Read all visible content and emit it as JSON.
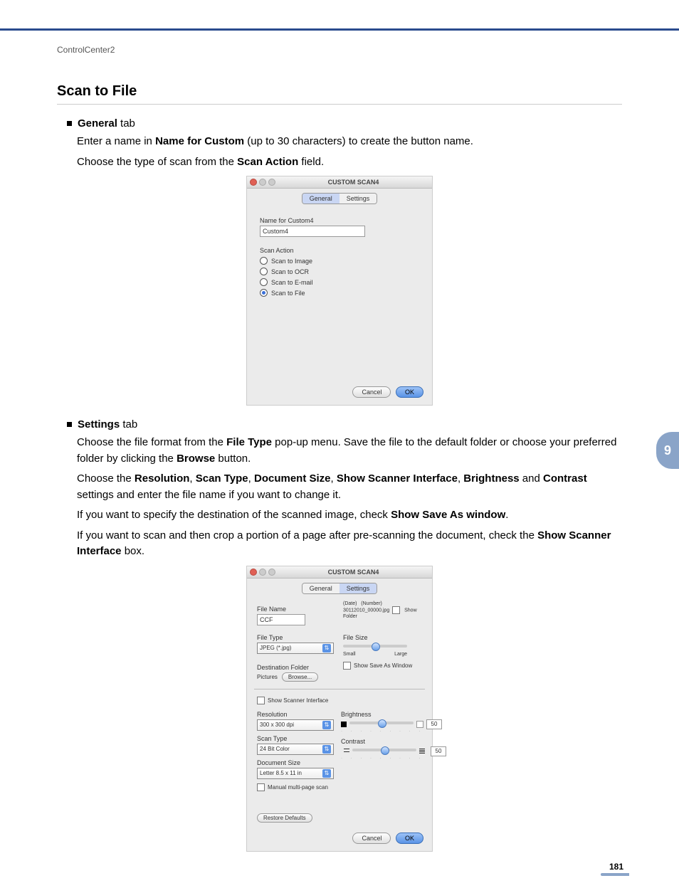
{
  "breadcrumb": "ControlCenter2",
  "heading": "Scan to File",
  "bullets": {
    "general_tab_strong": "General",
    "general_tab_rest": " tab",
    "settings_tab_strong": "Settings",
    "settings_tab_rest": " tab"
  },
  "paras": {
    "g1_a": "Enter a name in ",
    "g1_b": "Name for Custom",
    "g1_c": " (up to 30 characters) to create the button name.",
    "g2_a": "Choose the type of scan from the ",
    "g2_b": "Scan Action",
    "g2_c": " field.",
    "s1_a": "Choose the file format from the ",
    "s1_b": "File Type",
    "s1_c": " pop-up menu. Save the file to the default folder or choose your preferred folder by clicking the ",
    "s1_d": "Browse",
    "s1_e": " button.",
    "s2_a": "Choose the ",
    "s2_b": "Resolution",
    "s2_c": ", ",
    "s2_d": "Scan Type",
    "s2_e": ", ",
    "s2_f": "Document Size",
    "s2_g": ", ",
    "s2_h": "Show Scanner Interface",
    "s2_i": ", ",
    "s2_j": "Brightness",
    "s2_k": " and ",
    "s2_l": "Contrast",
    "s2_m": " settings and enter the file name if you want to change it.",
    "s3_a": "If you want to specify the destination of the scanned image, check ",
    "s3_b": "Show Save As window",
    "s3_c": ".",
    "s4_a": "If you want to scan and then crop a portion of a page after pre-scanning the document, check the ",
    "s4_b": "Show Scanner Interface",
    "s4_c": " box."
  },
  "shot1": {
    "title": "CUSTOM SCAN4",
    "tab_general": "General",
    "tab_settings": "Settings",
    "name_label": "Name for Custom4",
    "name_value": "Custom4",
    "action_label": "Scan Action",
    "opt_image": "Scan to Image",
    "opt_ocr": "Scan to OCR",
    "opt_email": "Scan to E-mail",
    "opt_file": "Scan to File",
    "cancel": "Cancel",
    "ok": "OK"
  },
  "shot2": {
    "title": "CUSTOM SCAN4",
    "tab_general": "General",
    "tab_settings": "Settings",
    "filename_lbl": "File Name",
    "filename_val": "CCF",
    "date_lbl": "(Date)",
    "number_lbl": "(Number)",
    "date_sample": "30112010_00000.jpg",
    "show_folder": "Show Folder",
    "filetype_lbl": "File Type",
    "filetype_val": "JPEG (*.jpg)",
    "filesize_lbl": "File Size",
    "small": "Small",
    "large": "Large",
    "dest_lbl": "Destination Folder",
    "dest_val": "Pictures",
    "browse": "Browse...",
    "show_save_as": "Show Save As Window",
    "show_scanner_if": "Show Scanner Interface",
    "res_lbl": "Resolution",
    "res_val": "300 x 300 dpi",
    "brightness_lbl": "Brightness",
    "scantype_lbl": "Scan Type",
    "scantype_val": "24 Bit Color",
    "contrast_lbl": "Contrast",
    "docsize_lbl": "Document Size",
    "docsize_val": "Letter 8.5 x 11 in",
    "slider_val": "50",
    "manual_multi": "Manual multi-page scan",
    "restore": "Restore Defaults",
    "cancel": "Cancel",
    "ok": "OK"
  },
  "side_tab": "9",
  "page_number": "181"
}
